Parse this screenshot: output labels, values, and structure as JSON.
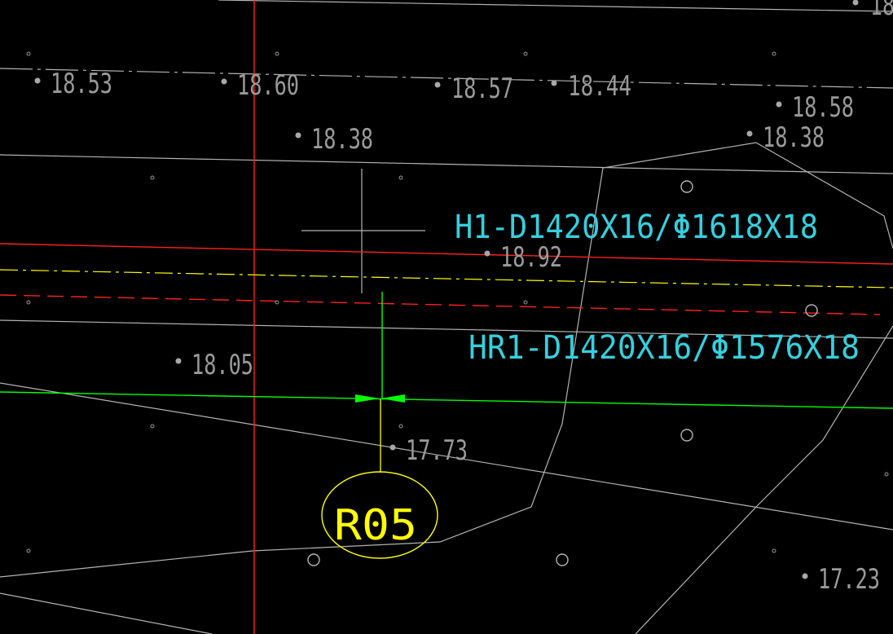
{
  "colors": {
    "background": "#000000",
    "gray_line": "#b4b4b4",
    "red_line": "#ff2020",
    "yellow_line": "#ffff00",
    "green_line": "#00ff00",
    "cyan_text": "#35d0de",
    "elevation_text": "#9a9a9a"
  },
  "elevations": [
    "18.53",
    "18.60",
    "18.57",
    "18.44",
    "18.58",
    "18.38",
    "18.38",
    "18.92",
    "18.05",
    "17.73",
    "17.23",
    "18"
  ],
  "pipes": {
    "h1_label": "H1-D1420X16/Φ1618X18",
    "hr1_label": "HR1-D1420X16/Φ1576X18"
  },
  "marker": {
    "label": "R05"
  }
}
